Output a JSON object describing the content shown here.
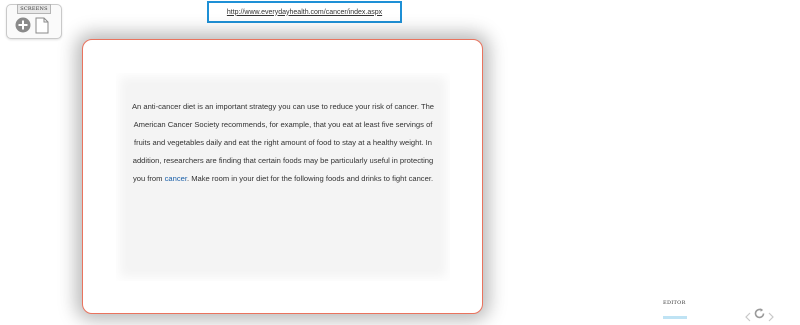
{
  "screens_panel": {
    "label": "SCREENS",
    "add_icon": "plus-circle-icon",
    "page_icon": "document-icon"
  },
  "url_bar": {
    "url": "http://www.everydayhealth.com/cancer/index.aspx",
    "border_color": "#1e90d6"
  },
  "card": {
    "border_color": "#e9735e",
    "text_before_link": "An anti-cancer diet is an important strategy you can use to reduce your risk of cancer. The American Cancer Society recommends, for example, that you eat at least five servings of fruits and vegetables daily and eat the right amount of food to stay at a healthy weight. In addition, researchers are finding that certain foods may be particularly useful in protecting you from ",
    "link_text": "cancer",
    "text_after_link": ". Make room in your diet for the following foods and drinks to fight cancer.",
    "link_color": "#1a5fa8"
  },
  "editor": {
    "label": "EDITOR",
    "refresh_icon": "refresh-icon",
    "arrow_left_icon": "chevron-left-icon",
    "arrow_right_icon": "chevron-right-icon"
  }
}
